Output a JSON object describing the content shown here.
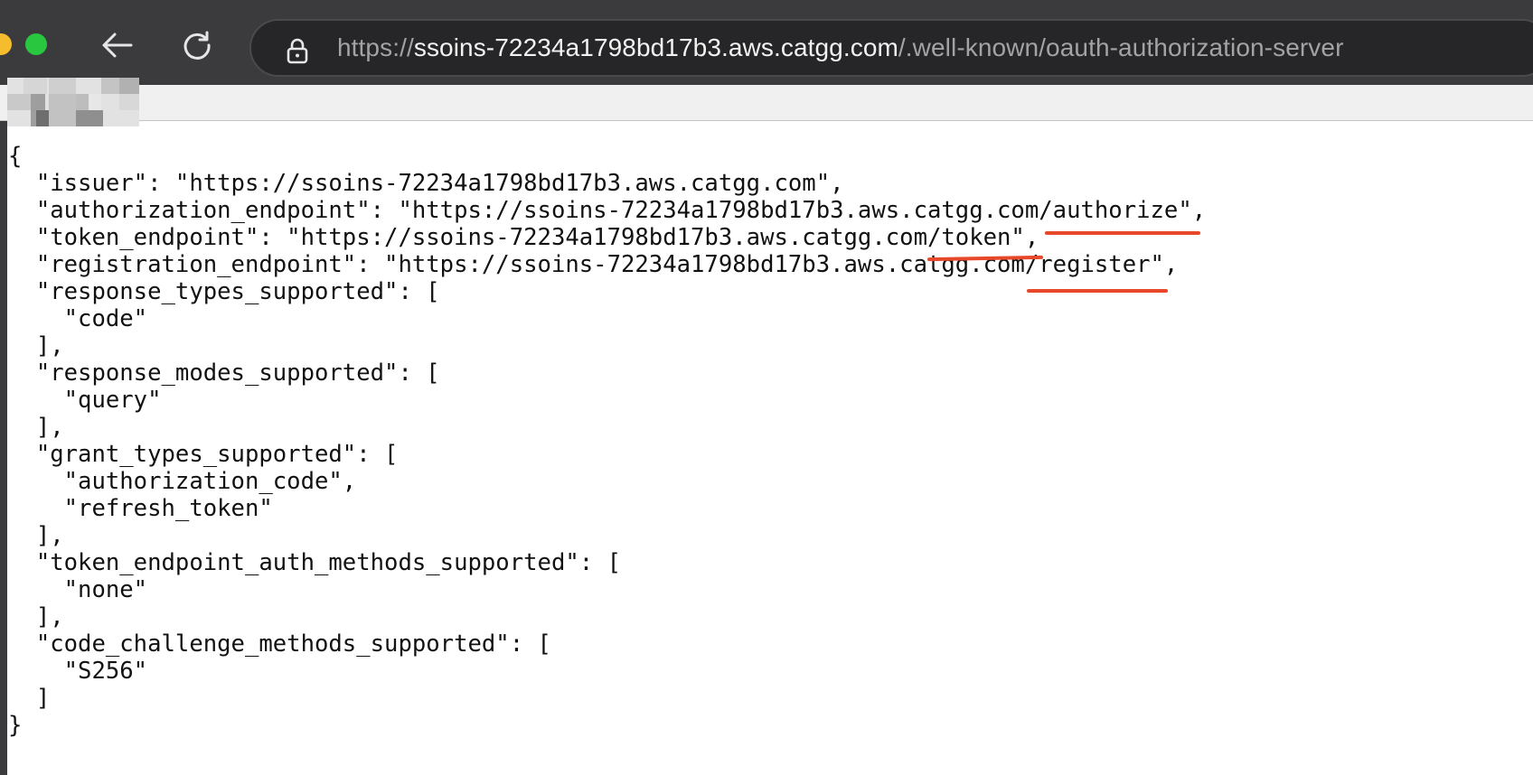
{
  "browser": {
    "url_scheme": "https://",
    "url_host": "ssoins-72234a1798bd17b3.aws.catgg.com",
    "url_path": "/.well-known/oauth-authorization-server"
  },
  "json": {
    "open_brace": "{",
    "issuer": "  \"issuer\": \"https://ssoins-72234a1798bd17b3.aws.catgg.com\",",
    "authorization_endpoint": "  \"authorization_endpoint\": \"https://ssoins-72234a1798bd17b3.aws.catgg.com/authorize\",",
    "token_endpoint": "  \"token_endpoint\": \"https://ssoins-72234a1798bd17b3.aws.catgg.com/token\",",
    "registration_endpoint": "  \"registration_endpoint\": \"https://ssoins-72234a1798bd17b3.aws.catgg.com/register\",",
    "response_types_key": "  \"response_types_supported\": [",
    "response_types_value": "    \"code\"",
    "response_types_close": "  ],",
    "response_modes_key": "  \"response_modes_supported\": [",
    "response_modes_value": "    \"query\"",
    "response_modes_close": "  ],",
    "grant_types_key": "  \"grant_types_supported\": [",
    "grant_types_value_1": "    \"authorization_code\",",
    "grant_types_value_2": "    \"refresh_token\"",
    "grant_types_close": "  ],",
    "auth_methods_key": "  \"token_endpoint_auth_methods_supported\": [",
    "auth_methods_value": "    \"none\"",
    "auth_methods_close": "  ],",
    "challenge_key": "  \"code_challenge_methods_supported\": [",
    "challenge_value": "    \"S256\"",
    "challenge_close": "  ]",
    "close_brace": "}"
  },
  "colors": {
    "chrome": "#3b3b3d",
    "address_bar": "#262628",
    "annotation": "#e8482a"
  },
  "icons": [
    "back-arrow-icon",
    "reload-icon",
    "lock-icon"
  ]
}
